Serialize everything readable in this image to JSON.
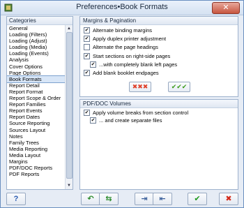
{
  "window": {
    "title": "Preferences•Book Formats",
    "close_glyph": "✕"
  },
  "categories": {
    "header": "Categories",
    "items": [
      "General",
      "Loading (Filters)",
      "Loading (Adjust)",
      "Loading (Media)",
      "Loading (Events)",
      "Analysis",
      "Cover Options",
      "Page Options",
      "Book Formats",
      "Report Detail",
      "Report Format",
      "Report Scope & Order",
      "Report Families",
      "Report Events",
      "Report Dates",
      "Source Reporting",
      "Sources Layout",
      "Notes",
      "Family Trees",
      "Media Reporting",
      "Media Layout",
      "Margins",
      "PDF/DOC Reports",
      "PDF Reports"
    ],
    "selected": "Book Formats",
    "scroll_up_glyph": "▲",
    "scroll_down_glyph": "▼"
  },
  "margins": {
    "header": "Margins & Pagination",
    "options": [
      {
        "label": "Alternate binding margins",
        "checked": true,
        "mark": "✔"
      },
      {
        "label": "Apply duplex printer adjustment",
        "checked": true,
        "mark": "✔"
      },
      {
        "label": "Alternate the page headings",
        "checked": false,
        "mark": ""
      },
      {
        "label": "Start sections on right-side pages",
        "checked": true,
        "mark": "✔"
      },
      {
        "label": "...with completely blank left pages",
        "checked": true,
        "mark": "✔"
      },
      {
        "label": "Add blank booklet endpages",
        "checked": true,
        "mark": "✔"
      }
    ],
    "clear_all_glyph": "✖✖✖",
    "check_all_glyph": "✔✔✔"
  },
  "pdf": {
    "header": "PDF/DOC Volumes",
    "options": [
      {
        "label": "Apply volume breaks from section control",
        "checked": true,
        "mark": "✔"
      },
      {
        "label": "... and create separate files",
        "checked": true,
        "mark": "✔"
      }
    ]
  },
  "footer": {
    "help_glyph": "?",
    "undo_glyph": "↶",
    "undo_all_glyph": "⇆",
    "export_glyph": "⇥",
    "import_glyph": "⇤",
    "ok_glyph": "✔",
    "cancel_glyph": "✖"
  },
  "colors": {
    "accent": "#6a8fc0",
    "ok_green": "#1f9a1f",
    "cancel_red": "#d42a1a",
    "clear_red": "#e0402a",
    "check_green": "#3a9b1a"
  }
}
